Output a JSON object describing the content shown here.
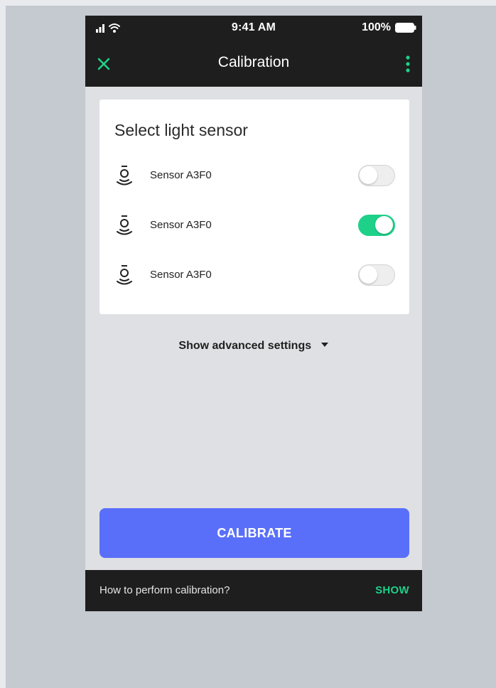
{
  "status_bar": {
    "time": "9:41 AM",
    "battery": "100%"
  },
  "nav": {
    "title": "Calibration"
  },
  "card": {
    "title": "Select light sensor",
    "sensors": [
      {
        "label": "Sensor A3F0",
        "enabled": false
      },
      {
        "label": "Sensor A3F0",
        "enabled": true
      },
      {
        "label": "Sensor A3F0",
        "enabled": false
      }
    ]
  },
  "advanced": {
    "label": "Show advanced settings"
  },
  "calibrate": {
    "label": "CALIBRATE"
  },
  "footer": {
    "prompt": "How to perform calibration?",
    "action": "SHOW"
  },
  "colors": {
    "accent": "#1ed189",
    "primary": "#5a6ff9",
    "bar": "#1e1e1e"
  },
  "icons": [
    "signal-icon",
    "wifi-icon",
    "battery-icon",
    "close-icon",
    "more-vertical-icon",
    "light-sensor-icon",
    "caret-down-icon"
  ]
}
